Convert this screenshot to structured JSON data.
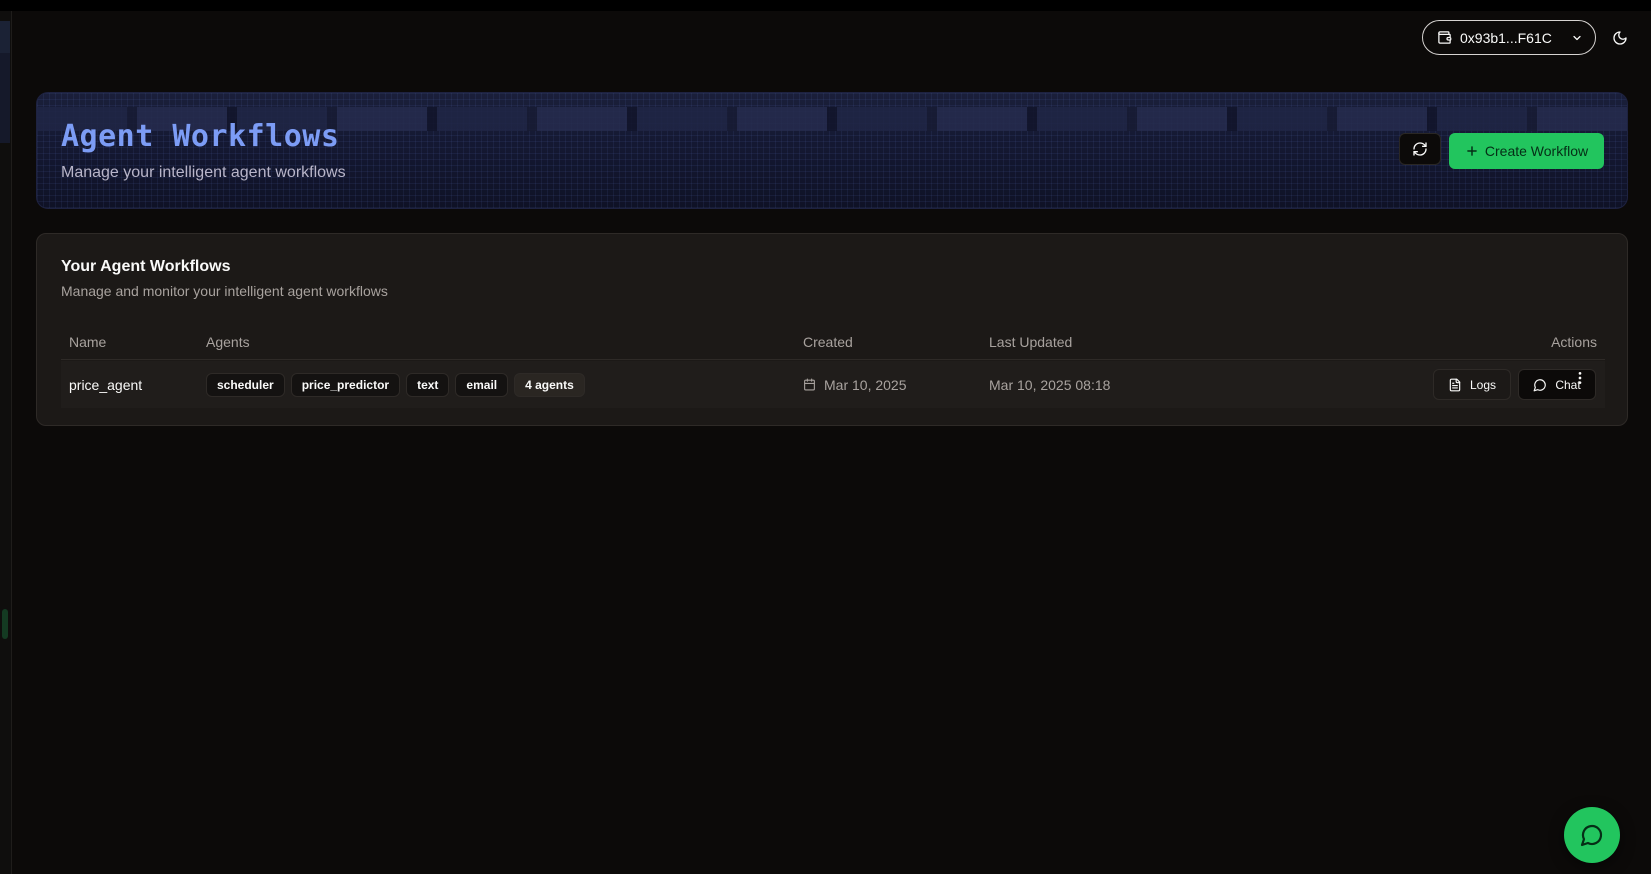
{
  "wallet": {
    "address": "0x93b1...F61C"
  },
  "header": {
    "title": "Agent Workflows",
    "subtitle": "Manage your intelligent agent workflows",
    "create_label": "Create Workflow"
  },
  "card": {
    "title": "Your Agent Workflows",
    "description": "Manage and monitor your intelligent agent workflows",
    "columns": [
      "Name",
      "Agents",
      "Created",
      "Last Updated",
      "Actions"
    ],
    "rows": [
      {
        "name": "price_agent",
        "agents": [
          "scheduler",
          "price_predictor",
          "text",
          "email"
        ],
        "agent_count": "4 agents",
        "created": "Mar 10, 2025",
        "updated": "Mar 10, 2025 08:18",
        "logs_label": "Logs",
        "chat_label": "Chat"
      }
    ]
  },
  "colors": {
    "accent": "#22c55e",
    "title": "#7c9cf5",
    "background": "#0c0a09"
  },
  "icons": [
    "wallet-icon",
    "chevron-down-icon",
    "moon-icon",
    "refresh-icon",
    "plus-icon",
    "calendar-icon",
    "file-text-icon",
    "message-circle-icon",
    "more-vertical-icon"
  ]
}
